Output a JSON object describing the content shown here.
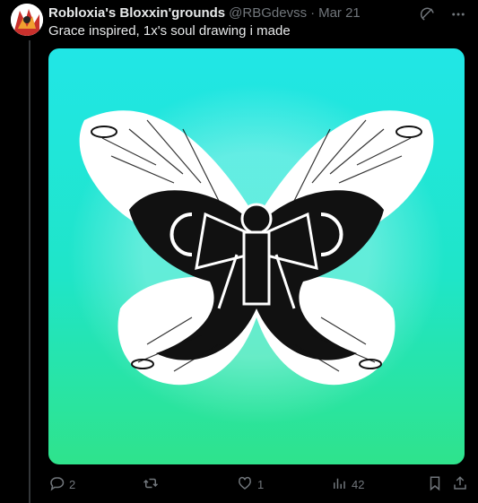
{
  "tweet": {
    "author_name": "Robloxia's Bloxxin'grounds",
    "handle": "@RBGdevss",
    "separator": "·",
    "date": "Mar 21",
    "text": "Grace inspired, 1x's soul drawing i made"
  },
  "actions": {
    "replies": "2",
    "reposts": "",
    "likes": "1",
    "views": "42"
  },
  "icons": {
    "top": [
      "grok-icon",
      "more-icon"
    ],
    "actions": [
      "reply-icon",
      "repost-icon",
      "like-icon",
      "views-icon",
      "bookmark-icon",
      "share-icon"
    ]
  },
  "colors": {
    "background": "#000000",
    "text": "#e7e9ea",
    "muted": "#71767b",
    "art_cyan": "#1fe5de",
    "art_green": "#2fe39a"
  }
}
